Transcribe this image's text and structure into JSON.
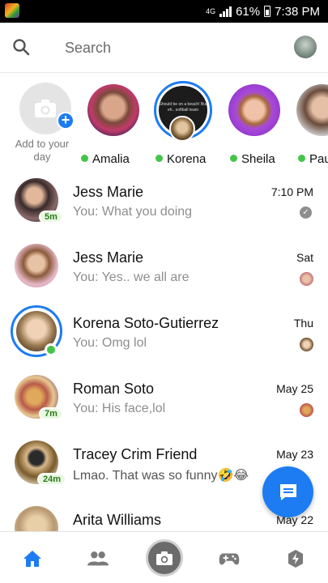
{
  "status_bar": {
    "signal_label": "4G",
    "battery": "61%",
    "time": "7:38 PM"
  },
  "search": {
    "placeholder": "Search"
  },
  "stories": [
    {
      "name": "Add to your day",
      "type": "add"
    },
    {
      "name": "Amalia",
      "online": true
    },
    {
      "name": "Korena",
      "online": true,
      "story_text": "Should be on a beach! But eh.. softball team"
    },
    {
      "name": "Sheila",
      "online": true
    },
    {
      "name": "Pau",
      "online": true
    }
  ],
  "chats": [
    {
      "name": "Jess Marie",
      "message": "You: What you doing",
      "time": "7:10 PM",
      "badge": "5m",
      "status": "sent-check"
    },
    {
      "name": "Jess Marie",
      "message": "You: Yes.. we all are",
      "time": "Sat",
      "badge": "",
      "status": "seen"
    },
    {
      "name": "Korena Soto-Gutierrez",
      "message": "You: Omg lol",
      "time": "Thu",
      "badge": "",
      "status": "seen",
      "online": true,
      "has_story": true
    },
    {
      "name": "Roman Soto",
      "message": "You: His face,lol",
      "time": "May 25",
      "badge": "7m",
      "status": "seen"
    },
    {
      "name": "Tracey Crim Friend",
      "message": "Lmao.  That was so funny🤣😂",
      "time": "May 23",
      "badge": "24m",
      "status": ""
    },
    {
      "name": "Arita Williams",
      "message": "",
      "time": "May 22",
      "badge": "",
      "status": ""
    }
  ],
  "bottom_nav": [
    {
      "icon": "home-icon",
      "active": true
    },
    {
      "icon": "people-icon",
      "active": false
    },
    {
      "icon": "camera-icon",
      "active": false
    },
    {
      "icon": "games-icon",
      "active": false
    },
    {
      "icon": "discover-icon",
      "active": false
    }
  ],
  "colors": {
    "accent": "#1d7cf2",
    "online": "#44c548",
    "muted_text": "#8e8e8e",
    "status_bar": "#000000"
  }
}
